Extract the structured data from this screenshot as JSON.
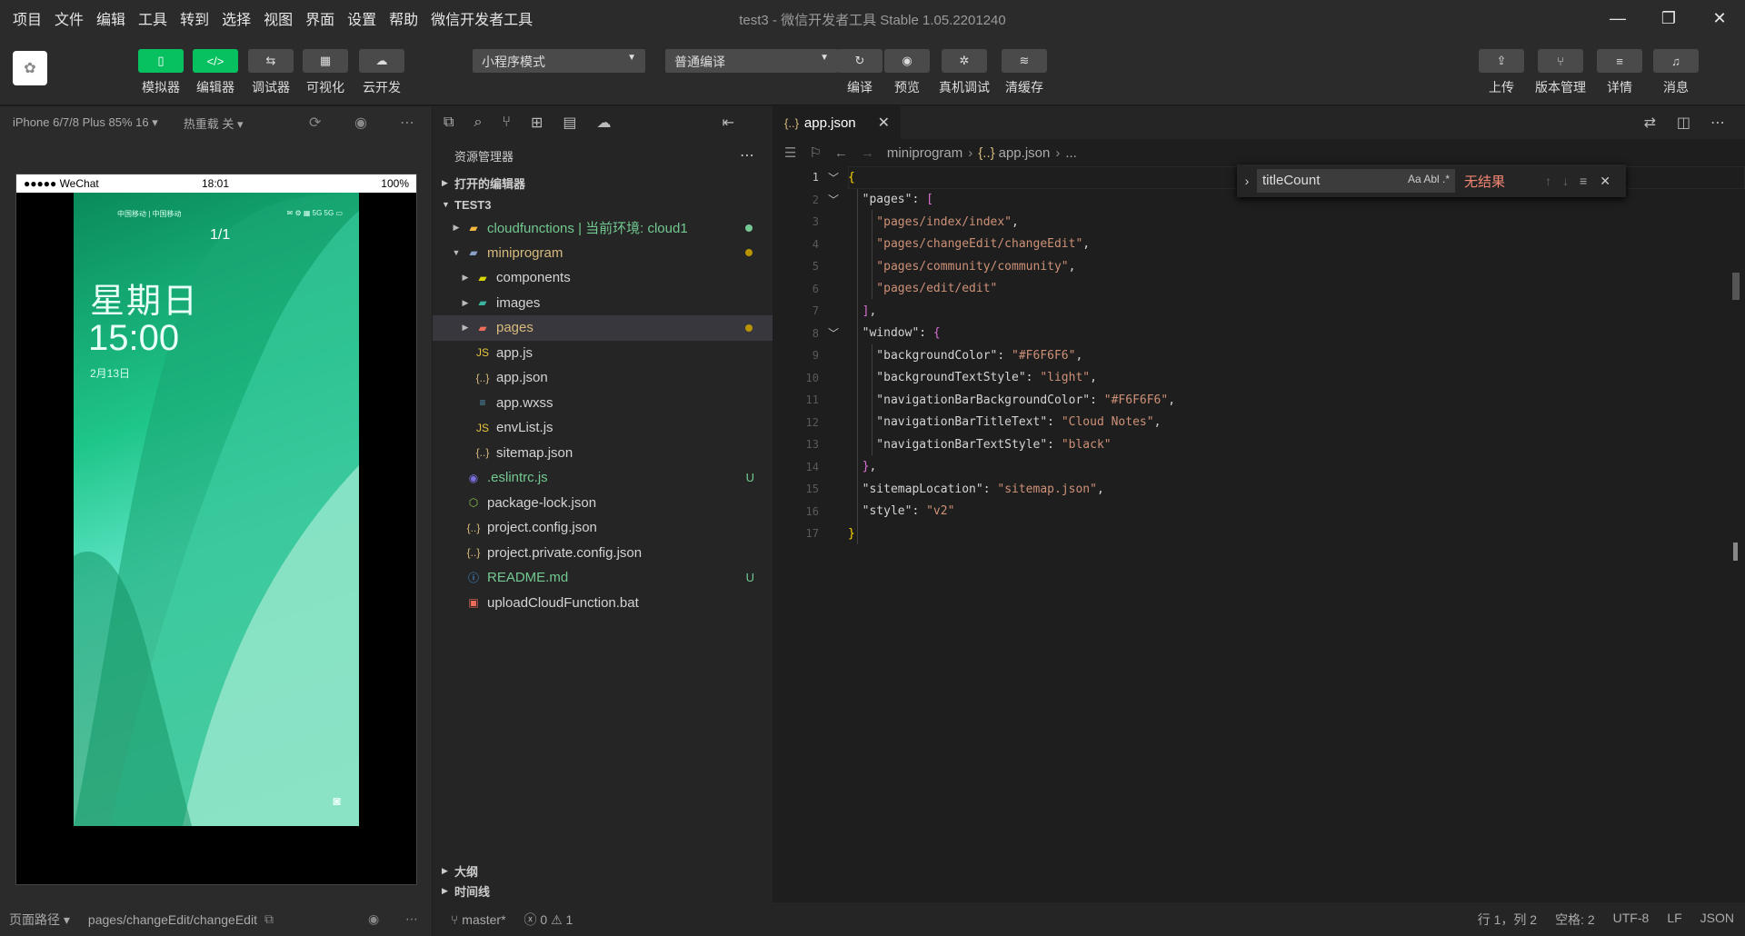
{
  "menu": [
    "项目",
    "文件",
    "编辑",
    "工具",
    "转到",
    "选择",
    "视图",
    "界面",
    "设置",
    "帮助",
    "微信开发者工具"
  ],
  "window": {
    "title_project": "test3",
    "title_app": "- 微信开发者工具 Stable 1.05.2201240"
  },
  "toolbar": {
    "left_buttons": [
      {
        "label": "模拟器",
        "glyph": "▯",
        "active": true
      },
      {
        "label": "编辑器",
        "glyph": "</>",
        "active": true
      },
      {
        "label": "调试器",
        "glyph": "⇆",
        "active": false
      },
      {
        "label": "可视化",
        "glyph": "▦",
        "active": false
      },
      {
        "label": "云开发",
        "glyph": "☁",
        "active": false
      }
    ],
    "mode_select": "小程序模式",
    "compile_select": "普通编译",
    "mid_buttons": [
      {
        "label": "编译",
        "glyph": "↻"
      },
      {
        "label": "预览",
        "glyph": "◉"
      },
      {
        "label": "真机调试",
        "glyph": "✲"
      },
      {
        "label": "清缓存",
        "glyph": "≋"
      }
    ],
    "right_buttons": [
      {
        "label": "上传",
        "glyph": "⇪"
      },
      {
        "label": "版本管理",
        "glyph": "⑂"
      },
      {
        "label": "详情",
        "glyph": "≡"
      },
      {
        "label": "消息",
        "glyph": "♫"
      }
    ]
  },
  "simulator": {
    "device": "iPhone 6/7/8 Plus 85% 16 ▾",
    "hot_reload": "热重载 关 ▾",
    "status_left": "●●●●● WeChat",
    "status_time": "18:01",
    "status_right": "100%",
    "lock_carrier": "中国移动 | 中国移动",
    "lock_icons": "✉ ⚙ ▦ 5G 5G ▭",
    "lock_weekday": "星期日",
    "lock_time": "15:00",
    "lock_date": "2月13日",
    "lock_lock": "1/1"
  },
  "sim_footer": {
    "path_label": "页面路径 ▾",
    "path_value": "pages/changeEdit/changeEdit"
  },
  "explorer": {
    "title": "资源管理器",
    "open_editors": "打开的编辑器",
    "project": "TEST3",
    "outline": "大纲",
    "timeline": "时间线",
    "tree": [
      {
        "name": "cloudfunctions | 当前环境: cloud1",
        "depth": 1,
        "arrow": "▶",
        "icon": "▰",
        "icon_color": "#f5b942",
        "color": "#73c991",
        "dot": "#73c991"
      },
      {
        "name": "miniprogram",
        "depth": 1,
        "arrow": "▼",
        "icon": "▰",
        "icon_color": "#8aa0c9",
        "color": "#d7ba7d",
        "dot": "#b89500"
      },
      {
        "name": "components",
        "depth": 2,
        "arrow": "▶",
        "icon": "▰",
        "icon_color": "#d7d700",
        "color": "#d4d4d4"
      },
      {
        "name": "images",
        "depth": 2,
        "arrow": "▶",
        "icon": "▰",
        "icon_color": "#3bb5a0",
        "color": "#d4d4d4"
      },
      {
        "name": "pages",
        "depth": 2,
        "arrow": "▶",
        "icon": "▰",
        "icon_color": "#ef6b5a",
        "color": "#d7ba7d",
        "dot": "#b89500",
        "selected": true
      },
      {
        "name": "app.js",
        "depth": 2,
        "arrow": "",
        "icon": "JS",
        "icon_color": "#e8c63b",
        "color": "#d4d4d4"
      },
      {
        "name": "app.json",
        "depth": 2,
        "arrow": "",
        "icon": "{..}",
        "icon_color": "#d7ba7d",
        "color": "#d4d4d4"
      },
      {
        "name": "app.wxss",
        "depth": 2,
        "arrow": "",
        "icon": "≡",
        "icon_color": "#519aba",
        "color": "#d4d4d4"
      },
      {
        "name": "envList.js",
        "depth": 2,
        "arrow": "",
        "icon": "JS",
        "icon_color": "#e8c63b",
        "color": "#d4d4d4"
      },
      {
        "name": "sitemap.json",
        "depth": 2,
        "arrow": "",
        "icon": "{..}",
        "icon_color": "#d7ba7d",
        "color": "#d4d4d4"
      },
      {
        "name": ".eslintrc.js",
        "depth": 1,
        "arrow": "",
        "icon": "◉",
        "icon_color": "#7b6fe0",
        "color": "#73c991",
        "badge": "U"
      },
      {
        "name": "package-lock.json",
        "depth": 1,
        "arrow": "",
        "icon": "⬡",
        "icon_color": "#8bc34a",
        "color": "#d4d4d4"
      },
      {
        "name": "project.config.json",
        "depth": 1,
        "arrow": "",
        "icon": "{..}",
        "icon_color": "#d7ba7d",
        "color": "#d4d4d4"
      },
      {
        "name": "project.private.config.json",
        "depth": 1,
        "arrow": "",
        "icon": "{..}",
        "icon_color": "#d7ba7d",
        "color": "#d4d4d4"
      },
      {
        "name": "README.md",
        "depth": 1,
        "arrow": "",
        "icon": "ⓘ",
        "icon_color": "#42a5f5",
        "color": "#73c991",
        "badge": "U"
      },
      {
        "name": "uploadCloudFunction.bat",
        "depth": 1,
        "arrow": "",
        "icon": "▣",
        "icon_color": "#ef6b5a",
        "color": "#d4d4d4"
      }
    ]
  },
  "editor": {
    "tab": "app.json",
    "breadcrumb": [
      "miniprogram",
      "app.json",
      "..."
    ],
    "lines": [
      {
        "n": 1,
        "fold": "﹀",
        "parts": [
          [
            "b1",
            "{"
          ]
        ]
      },
      {
        "n": 2,
        "fold": "﹀",
        "parts": [
          [
            "k",
            "  \"pages\": "
          ],
          [
            "b2",
            "["
          ]
        ]
      },
      {
        "n": 3,
        "fold": "",
        "parts": [
          [
            "s",
            "    \"pages/index/index\""
          ],
          [
            "k",
            ","
          ]
        ]
      },
      {
        "n": 4,
        "fold": "",
        "parts": [
          [
            "s",
            "    \"pages/changeEdit/changeEdit\""
          ],
          [
            "k",
            ","
          ]
        ]
      },
      {
        "n": 5,
        "fold": "",
        "parts": [
          [
            "s",
            "    \"pages/community/community\""
          ],
          [
            "k",
            ","
          ]
        ]
      },
      {
        "n": 6,
        "fold": "",
        "parts": [
          [
            "s",
            "    \"pages/edit/edit\""
          ]
        ]
      },
      {
        "n": 7,
        "fold": "",
        "parts": [
          [
            "b2",
            "  ]"
          ],
          [
            "k",
            ","
          ]
        ]
      },
      {
        "n": 8,
        "fold": "﹀",
        "parts": [
          [
            "k",
            "  \"window\": "
          ],
          [
            "b2",
            "{"
          ]
        ]
      },
      {
        "n": 9,
        "fold": "",
        "parts": [
          [
            "k",
            "    \"backgroundColor\": "
          ],
          [
            "s",
            "\"#F6F6F6\""
          ],
          [
            "k",
            ","
          ]
        ]
      },
      {
        "n": 10,
        "fold": "",
        "parts": [
          [
            "k",
            "    \"backgroundTextStyle\": "
          ],
          [
            "s",
            "\"light\""
          ],
          [
            "k",
            ","
          ]
        ]
      },
      {
        "n": 11,
        "fold": "",
        "parts": [
          [
            "k",
            "    \"navigationBarBackgroundColor\": "
          ],
          [
            "s",
            "\"#F6F6F6\""
          ],
          [
            "k",
            ","
          ]
        ]
      },
      {
        "n": 12,
        "fold": "",
        "parts": [
          [
            "k",
            "    \"navigationBarTitleText\": "
          ],
          [
            "s",
            "\"Cloud Notes\""
          ],
          [
            "k",
            ","
          ]
        ]
      },
      {
        "n": 13,
        "fold": "",
        "parts": [
          [
            "k",
            "    \"navigationBarTextStyle\": "
          ],
          [
            "s",
            "\"black\""
          ]
        ]
      },
      {
        "n": 14,
        "fold": "",
        "parts": [
          [
            "b2",
            "  }"
          ],
          [
            "k",
            ","
          ]
        ]
      },
      {
        "n": 15,
        "fold": "",
        "parts": [
          [
            "k",
            "  \"sitemapLocation\": "
          ],
          [
            "s",
            "\"sitemap.json\""
          ],
          [
            "k",
            ","
          ]
        ]
      },
      {
        "n": 16,
        "fold": "",
        "parts": [
          [
            "k",
            "  \"style\": "
          ],
          [
            "s",
            "\"v2\""
          ]
        ]
      },
      {
        "n": 17,
        "fold": "",
        "parts": [
          [
            "b1",
            "}"
          ]
        ]
      }
    ]
  },
  "find": {
    "query": "titleCount",
    "options": "Aa  Abl  .*",
    "no_results": "无结果"
  },
  "statusbar": {
    "branch": "⑂ master*",
    "problems": "ⓧ 0 ⚠ 1",
    "position": "行 1，列 2",
    "indent": "空格: 2",
    "encoding": "UTF-8",
    "eol": "LF",
    "language": "JSON"
  },
  "colors": {
    "accent_green": "#07c160",
    "git_untracked": "#73c991",
    "git_modified": "#d7ba7d",
    "find_no_result": "#f48771"
  }
}
